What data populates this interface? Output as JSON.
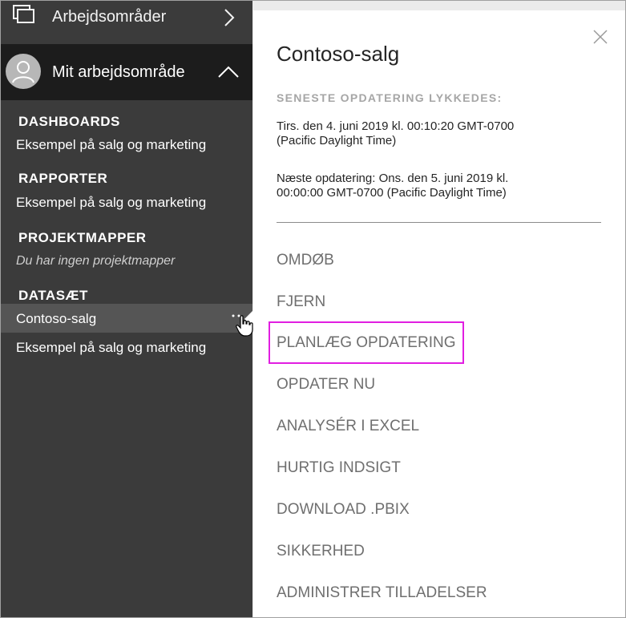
{
  "sidebar": {
    "workspaces_label": "Arbejdsområder",
    "my_workspace_label": "Mit arbejdsområde",
    "sections": {
      "dashboards": {
        "heading": "DASHBOARDS",
        "items": [
          "Eksempel på salg og marketing"
        ]
      },
      "reports": {
        "heading": "RAPPORTER",
        "items": [
          "Eksempel på salg og marketing"
        ]
      },
      "projects": {
        "heading": "PROJEKTMAPPER",
        "empty_text": "Du har ingen projektmapper"
      },
      "datasets": {
        "heading": "DATASÆT",
        "items": [
          "Contoso-salg",
          "Eksempel på salg og marketing"
        ],
        "selected": "Contoso-salg"
      }
    }
  },
  "panel": {
    "title": "Contoso-salg",
    "status_heading": "SENESTE OPDATERING LYKKEDES:",
    "last_refresh_line1": "Tirs. den 4. juni 2019 kl. 00:10:20 GMT-0700",
    "last_refresh_line2": "(Pacific Daylight Time)",
    "next_refresh_line1": "Næste opdatering: Ons. den 5. juni 2019 kl.",
    "next_refresh_line2": "00:00:00 GMT-0700 (Pacific Daylight Time)",
    "menu": [
      "OMDØB",
      "FJERN",
      "PLANLÆG OPDATERING",
      "OPDATER NU",
      "ANALYSÉR I EXCEL",
      "HURTIG INDSIGT",
      "DOWNLOAD .PBIX",
      "SIKKERHED",
      "ADMINISTRER TILLADELSER"
    ],
    "highlighted_item": "PLANLÆG OPDATERING"
  },
  "colors": {
    "sidebar_bg": "#3b3b3b",
    "header_bg": "#1c1c1c",
    "highlight_border": "#e11ee1"
  }
}
